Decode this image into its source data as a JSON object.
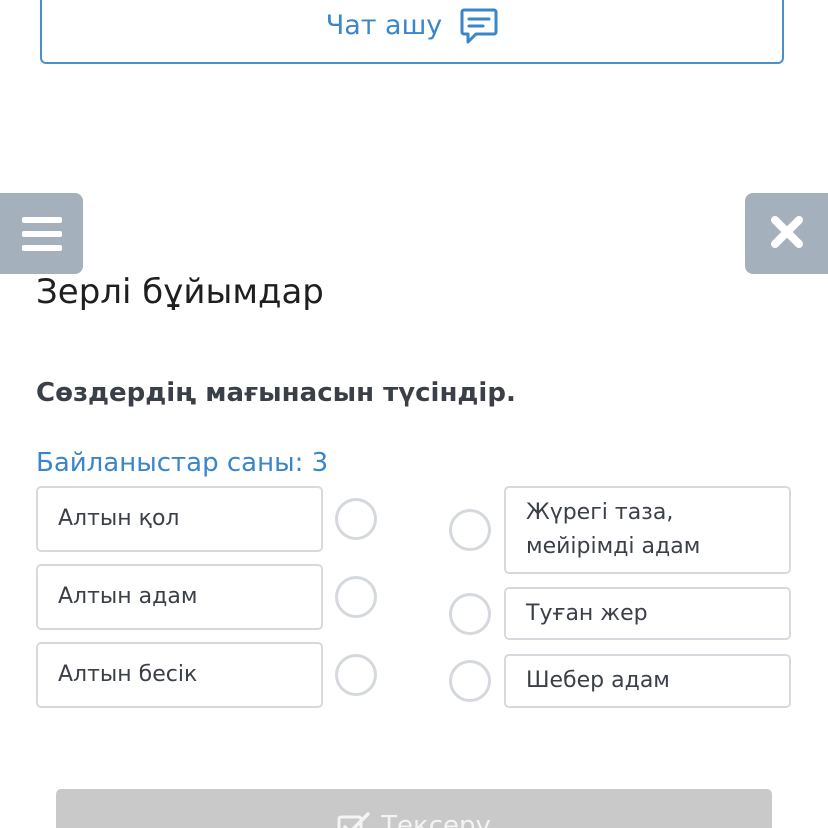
{
  "chat": {
    "label": "Чат ашу",
    "icon": "chat-icon",
    "accent_color": "#3a86c8"
  },
  "navigation": {
    "menu_icon": "hamburger-menu-icon",
    "close_icon": "close-icon",
    "button_color": "#a4b0bb"
  },
  "lesson": {
    "title": "Зерлі бұйымдар"
  },
  "task": {
    "instruction": "Сөздердің мағынасын түсіндір.",
    "connections_label": "Байланыстар саны: 3"
  },
  "matching": {
    "left_items": [
      {
        "label": "Алтын қол"
      },
      {
        "label": "Алтын адам"
      },
      {
        "label": "Алтын бесік"
      }
    ],
    "right_items": [
      {
        "label": "Жүрегі таза, мейірімді адам"
      },
      {
        "label": "Туған жер"
      },
      {
        "label": "Шебер адам"
      }
    ]
  },
  "check_button": {
    "label": "Тексеру",
    "icon": "checkbox-edit-icon",
    "state": "disabled"
  }
}
